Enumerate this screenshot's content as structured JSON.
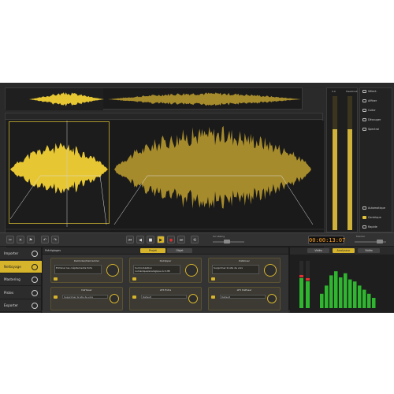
{
  "meters": {
    "label_left": "0.0",
    "label_right": "Mastérisé"
  },
  "side_tools": [
    {
      "label": "Sélect.",
      "active": false
    },
    {
      "label": "Affiner",
      "active": false
    },
    {
      "label": "Coller",
      "active": false
    },
    {
      "label": "Découper",
      "active": false
    },
    {
      "label": "Spectral",
      "active": false
    },
    {
      "label": "Automatique",
      "active": false
    },
    {
      "label": "Centrique",
      "active": true
    },
    {
      "label": "Rapide",
      "active": false
    }
  ],
  "transport": {
    "time": "00:00:13:07",
    "volume_label": "Monitor",
    "scrub_label": "Scrubbing",
    "buttons": [
      "⏮",
      "◀",
      "■",
      "▶",
      "●",
      "⏭"
    ]
  },
  "nav": [
    {
      "label": "Importer",
      "active": false
    },
    {
      "label": "Nettoyage",
      "active": true
    },
    {
      "label": "Mastering",
      "active": false
    },
    {
      "label": "Pistes",
      "active": false
    },
    {
      "label": "Exporter",
      "active": false
    }
  ],
  "fx": {
    "presets_label": "Préréglages",
    "tabs": [
      "Projet",
      "Objet"
    ],
    "cards": [
      {
        "title": "DeClicker/DeCrackler",
        "body": "Eliminer les crépitements forts"
      },
      {
        "title": "DeClipper",
        "body": "Surmodulation numérique/analogique à 0 dB"
      },
      {
        "title": "DeNoiser",
        "body": "Supprimer bruits de voix"
      },
      {
        "title": "DeHisser",
        "body": "Supprimer bruits de voix"
      },
      {
        "title": "aFX Extra",
        "body": "Default"
      },
      {
        "title": "aFX DeEsser",
        "body": "Default"
      }
    ]
  },
  "analyzer": {
    "tabs": [
      "Vidéo",
      "Analyseur",
      "Vidéo"
    ],
    "active": 1,
    "bar_levels": [
      0.35,
      0.55,
      0.8,
      0.9,
      0.75,
      0.85,
      0.7,
      0.65,
      0.55,
      0.45,
      0.35,
      0.25
    ],
    "colors": {
      "bar": "#2fb52f",
      "peak": "#e03030"
    }
  },
  "colors": {
    "accent": "#d6b42c",
    "wave": "#e6c633",
    "wave_dim": "#a68b2c"
  }
}
